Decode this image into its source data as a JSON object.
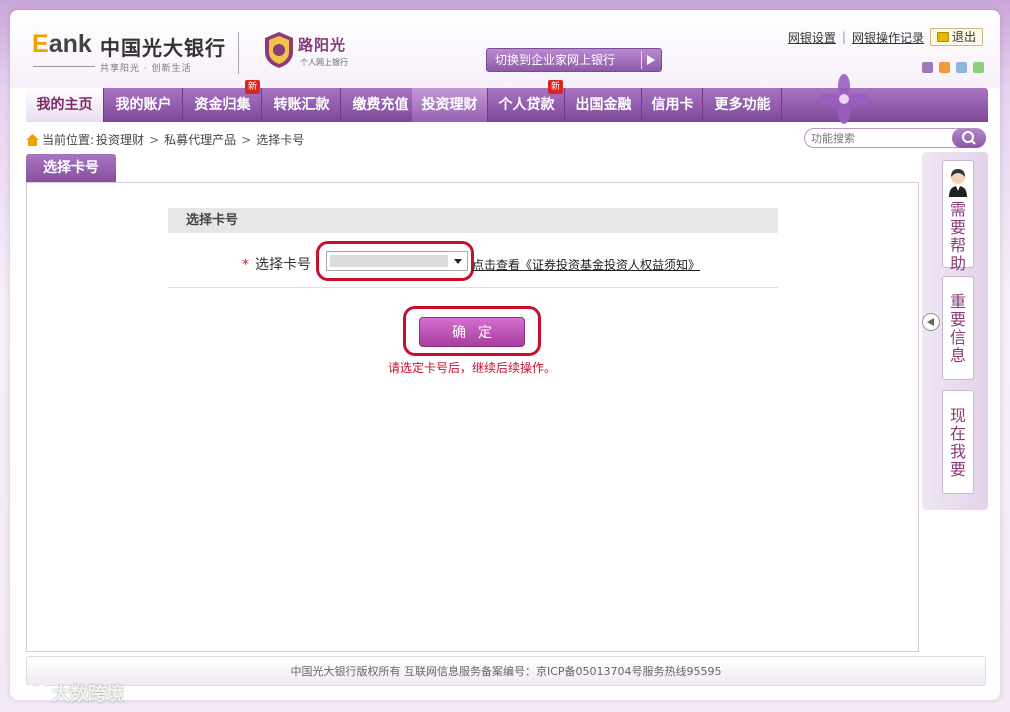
{
  "header": {
    "logo_e": "E",
    "logo_bank": "ank",
    "bank_name": "中国光大银行",
    "slogan": "共享阳光 · 创新生活",
    "sunshine_title": "路阳光",
    "sunshine_sub": "个人网上银行",
    "switch_label": "切换到企业家网上银行",
    "links": {
      "settings": "网银设置",
      "log": "网银操作记录",
      "logout": "退出"
    },
    "swatch_colors": [
      "#9a7ab8",
      "#f09a3c",
      "#8fb4e0",
      "#8ed07a"
    ]
  },
  "nav": {
    "items": [
      {
        "label": "我的主页"
      },
      {
        "label": "我的账户"
      },
      {
        "label": "资金归集",
        "badge": "新"
      },
      {
        "label": "转账汇款"
      },
      {
        "label": "缴费充值"
      },
      {
        "label": "投资理财"
      },
      {
        "label": "个人贷款",
        "badge": "新"
      },
      {
        "label": "出国金融"
      },
      {
        "label": "信用卡"
      },
      {
        "label": "更多功能"
      }
    ]
  },
  "breadcrumb": {
    "prefix": "当前位置:",
    "items": [
      "投资理财",
      "私募代理产品",
      "选择卡号"
    ],
    "separator": ">"
  },
  "search": {
    "placeholder": "功能搜索"
  },
  "page": {
    "tab": "选择卡号",
    "section_title": "选择卡号",
    "card_label": "选择卡号",
    "required_mark": "*",
    "notice_link": "点击查看《证券投资基金投资人权益须知》",
    "confirm": "确定",
    "hint": "请选定卡号后，继续后续操作。"
  },
  "side": {
    "help": [
      "需",
      "要",
      "帮",
      "助"
    ],
    "info": [
      "重",
      "要",
      "信",
      "息"
    ],
    "want": [
      "现",
      "在",
      "我",
      "要"
    ]
  },
  "footer": {
    "text": "中国光大银行版权所有 互联网信息服务备案编号：京ICP备05013704号服务热线95595"
  },
  "watermark": {
    "text": "大数跨境"
  },
  "colors": {
    "accent": "#8e5aa8",
    "highlight": "#c8102e",
    "confirm": "#a63e9f"
  }
}
